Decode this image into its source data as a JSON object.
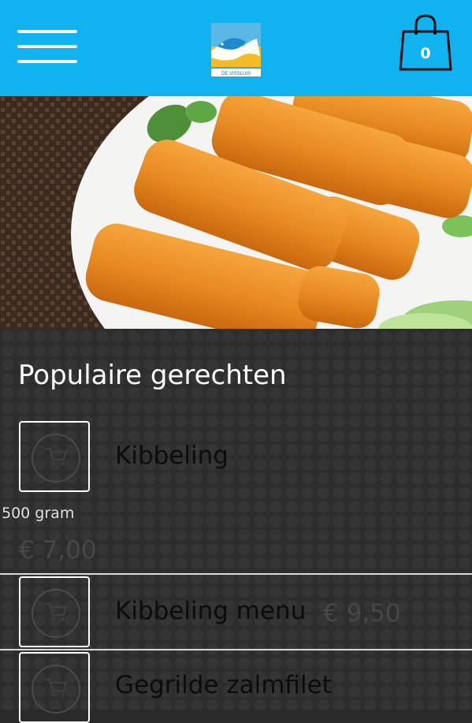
{
  "header": {
    "menu_icon": "hamburger-menu-icon",
    "logo_icon": "fish-logo-icon",
    "logo_text": "DE VISSLUIS",
    "cart_icon": "shopping-bag-icon",
    "cart_count": "0",
    "bg_color": "#11b2f0"
  },
  "hero": {
    "image_icon": "fish-sticks-photo"
  },
  "section": {
    "title": "Populaire gerechten"
  },
  "items": [
    {
      "name": "Kibbeling",
      "subtitle": "500 gram",
      "price": "€ 7,00",
      "thumb_icon": "cart-icon"
    },
    {
      "name": "Kibbeling menu",
      "price": "€ 9,50",
      "thumb_icon": "cart-icon"
    },
    {
      "name": "Gegrilde zalmfilet",
      "thumb_icon": "cart-icon"
    }
  ]
}
